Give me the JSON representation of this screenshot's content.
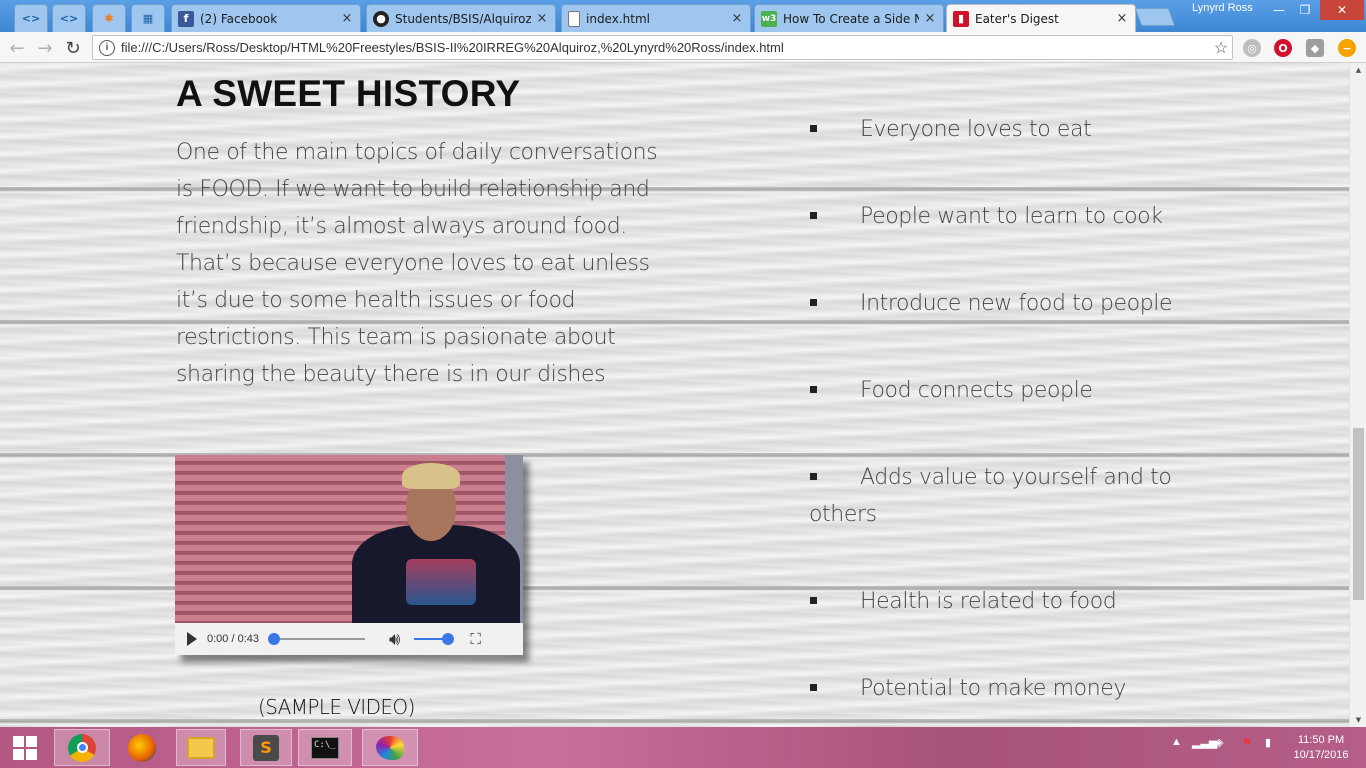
{
  "browser": {
    "tabs": [
      {
        "label": "",
        "icon": "code-icon"
      },
      {
        "label": "",
        "icon": "code-icon"
      },
      {
        "label": "",
        "icon": "avast-icon"
      },
      {
        "label": "",
        "icon": "grid-icon"
      },
      {
        "label": "(2) Facebook",
        "icon": "facebook-icon",
        "close": "×"
      },
      {
        "label": "Students/BSIS/Alquiroz-I",
        "icon": "github-icon",
        "close": "×"
      },
      {
        "label": "index.html",
        "icon": "file-icon",
        "close": "×"
      },
      {
        "label": "How To Create a Side Na",
        "icon": "w3schools-icon",
        "close": "×"
      },
      {
        "label": "Eater's Digest",
        "icon": "eaters-digest-icon",
        "close": "×",
        "active": true
      }
    ],
    "profile_name": "Lynyrd Ross",
    "url": "file:///C:/Users/Ross/Desktop/HTML%20Freestyles/BSIS-II%20IRREG%20Alquiroz,%20Lynyrd%20Ross/index.html"
  },
  "page": {
    "heading": "A SWEET HISTORY",
    "history_text": "One of the main topics of daily conversations is FOOD. If we want to build relationship and friendship, it’s almost always around food. That’s because everyone loves to eat unless it’s due to some health issues or food restrictions. This team is pasionate about sharing the beauty there is in our dishes",
    "video": {
      "time": "0:00 / 0:43",
      "progress": 0.0,
      "volume": 1.0
    },
    "video_caption": "(SAMPLE VIDEO)",
    "reasons": [
      "Everyone loves to eat",
      "People want to learn to cook",
      "Introduce new food to people",
      "Food connects people",
      "Adds value to yourself and to others",
      "Health is related to food",
      "Potential to make money"
    ]
  },
  "taskbar": {
    "apps": [
      "chrome-icon",
      "firefox-icon",
      "file-explorer-icon",
      "sublime-text-icon",
      "command-prompt-icon",
      "paint-icon"
    ],
    "clock_time": "11:50 PM",
    "clock_date": "10/17/2016"
  },
  "colors": {
    "tabstrip": "#4a90d9",
    "taskbar": "#b35783",
    "video_accent": "#3b78e7"
  }
}
